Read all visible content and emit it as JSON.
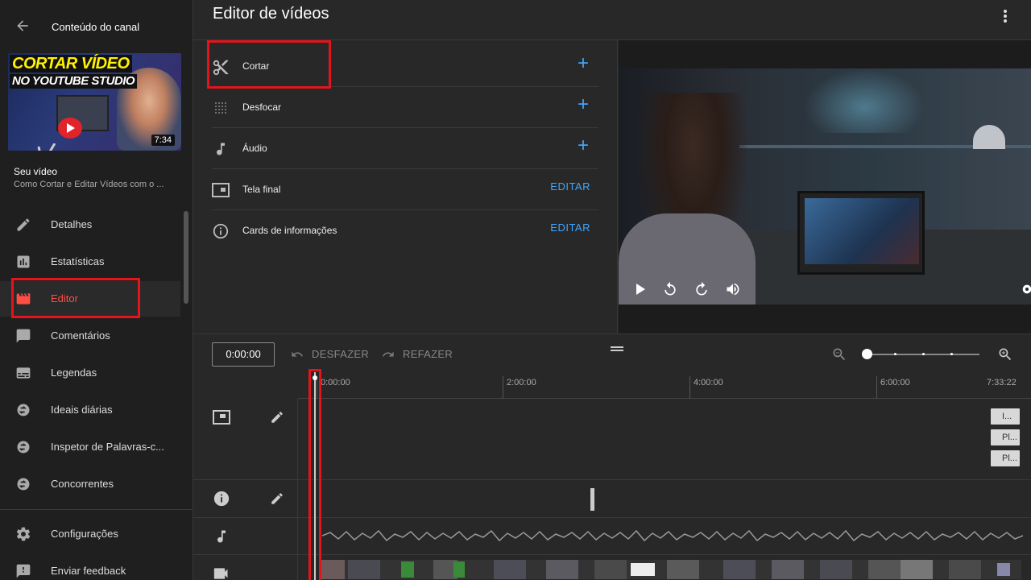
{
  "sidebar": {
    "back_label": "Conteúdo do canal",
    "thumbnail": {
      "line1": "CORTAR VÍDEO",
      "line2": "NO YOUTUBE STUDIO",
      "duration": "7:34"
    },
    "video_caption_title": "Seu vídeo",
    "video_caption_subtitle": "Como Cortar e Editar Vídeos com o ...",
    "nav_items": [
      {
        "label": "Detalhes",
        "icon": "pencil-icon"
      },
      {
        "label": "Estatísticas",
        "icon": "analytics-icon"
      },
      {
        "label": "Editor",
        "icon": "clapperboard-icon",
        "active": true
      },
      {
        "label": "Comentários",
        "icon": "comment-icon"
      },
      {
        "label": "Legendas",
        "icon": "subtitles-icon"
      },
      {
        "label": "Ideais diárias",
        "icon": "extension-icon"
      },
      {
        "label": "Inspetor de Palavras-c...",
        "icon": "extension-icon"
      },
      {
        "label": "Concorrentes",
        "icon": "extension-icon"
      }
    ],
    "bottom_items": [
      {
        "label": "Configurações",
        "icon": "gear-icon"
      },
      {
        "label": "Enviar feedback",
        "icon": "feedback-icon"
      }
    ]
  },
  "header": {
    "title": "Editor de vídeos"
  },
  "tools": [
    {
      "label": "Cortar",
      "icon": "scissors-icon",
      "action": "+"
    },
    {
      "label": "Desfocar",
      "icon": "blur-icon",
      "action": "+"
    },
    {
      "label": "Áudio",
      "icon": "music-note-icon",
      "action": "+"
    },
    {
      "label": "Tela final",
      "icon": "end-screen-icon",
      "action": "EDITAR"
    },
    {
      "label": "Cards de informações",
      "icon": "info-icon",
      "action": "EDITAR"
    }
  ],
  "timeline": {
    "current_time": "0:00:00",
    "undo_label": "DESFAZER",
    "redo_label": "REFAZER",
    "ruler_labels": [
      "0:00:00",
      "2:00:00",
      "4:00:00",
      "6:00:00",
      "7:33:22"
    ],
    "endscreen_chips": [
      "I...",
      "Pl...",
      "Pl..."
    ]
  },
  "colors": {
    "accent_blue": "#3ea6ff",
    "active_red": "#ff4e45",
    "highlight_red": "#e3141b"
  }
}
